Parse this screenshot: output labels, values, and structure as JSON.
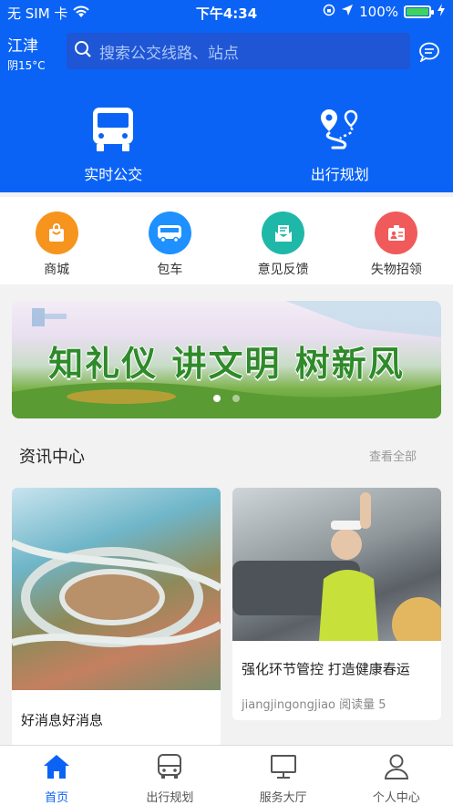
{
  "statusbar": {
    "carrier": "无 SIM 卡",
    "time": "下午4:34",
    "battery": "100%"
  },
  "header": {
    "city": "江津",
    "weather": "阴15°C",
    "search_placeholder": "搜索公交线路、站点",
    "big_items": [
      {
        "label": "实时公交",
        "icon": "bus-icon"
      },
      {
        "label": "出行规划",
        "icon": "route-icon"
      }
    ]
  },
  "quick_items": [
    {
      "label": "商城",
      "icon": "shopping-bag-icon",
      "color": "#f7941d"
    },
    {
      "label": "包车",
      "icon": "bus-icon",
      "color": "#1e90ff"
    },
    {
      "label": "意见反馈",
      "icon": "feedback-icon",
      "color": "#1fb8a8"
    },
    {
      "label": "失物招领",
      "icon": "lost-found-icon",
      "color": "#f05a5a"
    }
  ],
  "banner": {
    "slogan": "知礼仪 讲文明 树新风",
    "slides": 2,
    "active_slide": 1
  },
  "news": {
    "title": "资讯中心",
    "more": "查看全部",
    "items": [
      {
        "title": "好消息好消息",
        "meta": ""
      },
      {
        "title": "强化环节管控 打造健康春运",
        "meta": "jiangjingongjiao  阅读量 5"
      }
    ]
  },
  "tabbar": [
    {
      "label": "首页",
      "active": true
    },
    {
      "label": "出行规划",
      "active": false
    },
    {
      "label": "服务大厅",
      "active": false
    },
    {
      "label": "个人中心",
      "active": false
    }
  ],
  "colors": {
    "primary": "#0b63f6"
  }
}
